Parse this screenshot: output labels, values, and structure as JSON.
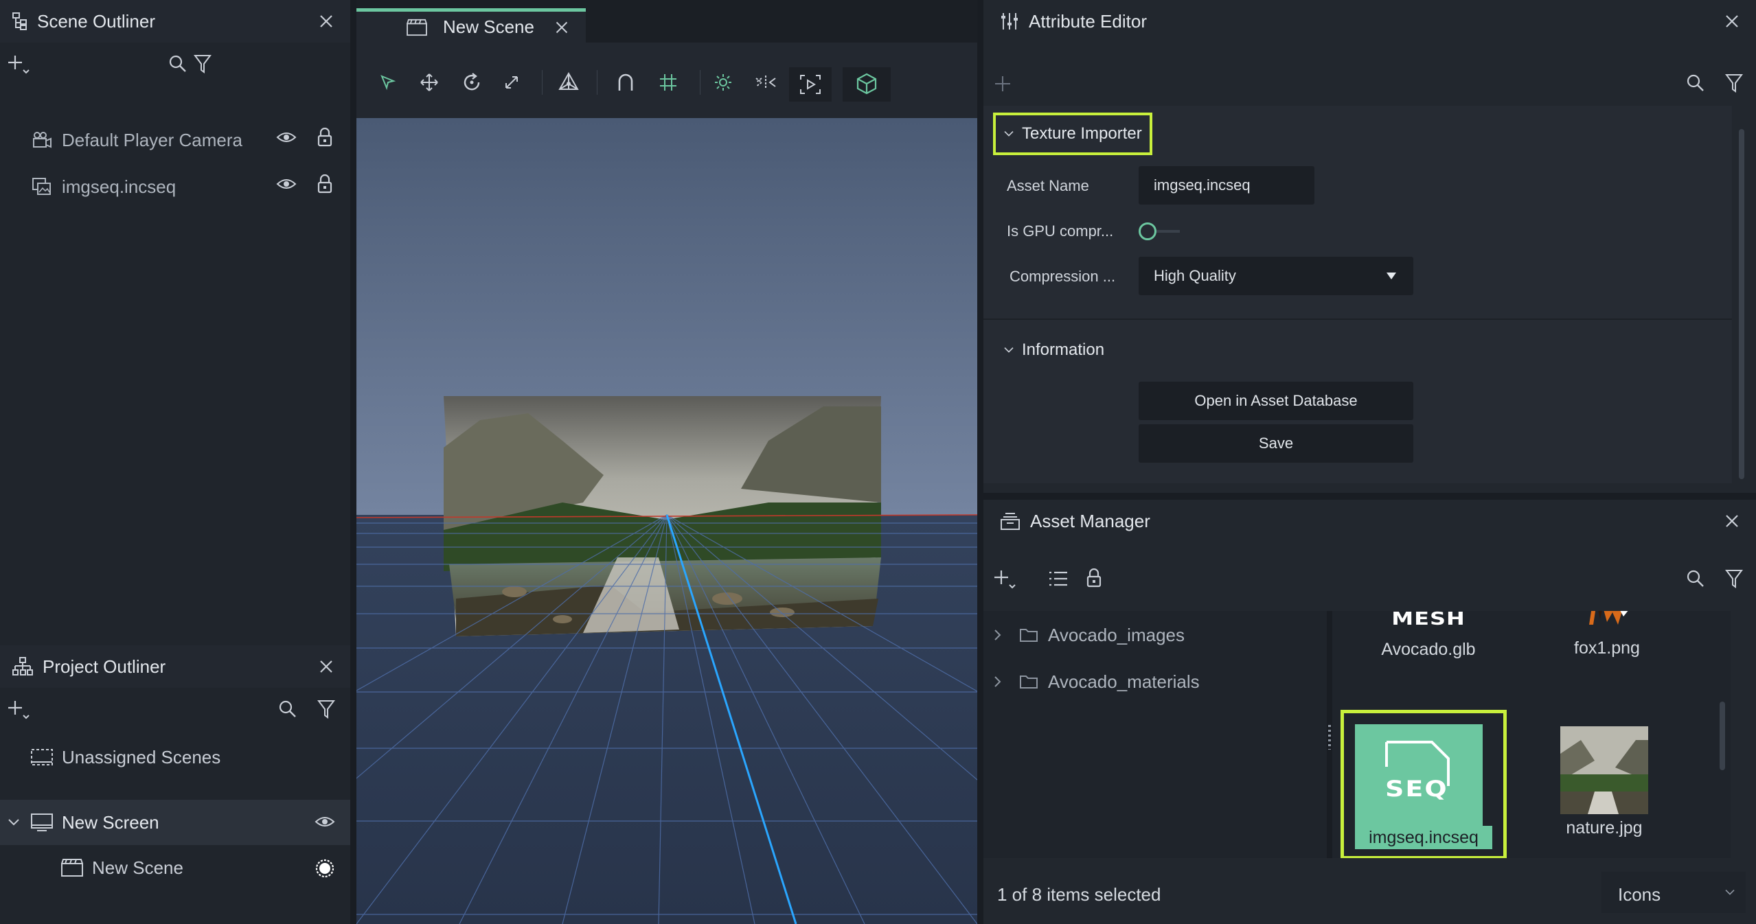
{
  "scene_outliner": {
    "title": "Scene Outliner",
    "items": [
      {
        "label": "Default Player Camera"
      },
      {
        "label": "imgseq.incseq"
      }
    ]
  },
  "project_outliner": {
    "title": "Project Outliner",
    "items": [
      {
        "label": "Unassigned Scenes"
      },
      {
        "label": "New Screen"
      },
      {
        "label": "New Scene"
      }
    ]
  },
  "viewport": {
    "tab_label": "New Scene"
  },
  "attribute_editor": {
    "title": "Attribute Editor",
    "texture_section": "Texture Importer",
    "asset_name_label": "Asset Name",
    "asset_name_value": "imgseq.incseq",
    "gpu_label": "Is GPU compr...",
    "compression_label": "Compression ...",
    "compression_value": "High Quality",
    "info_section": "Information",
    "open_btn": "Open in Asset Database",
    "save_btn": "Save"
  },
  "asset_manager": {
    "title": "Asset Manager",
    "folders": [
      {
        "label": "Avocado_images"
      },
      {
        "label": "Avocado_materials"
      }
    ],
    "assets": [
      {
        "label": "Avocado.glb",
        "thumb_text": "MESH"
      },
      {
        "label": "fox1.png"
      },
      {
        "label": "imgseq.incseq",
        "thumb_text": "SEQ"
      },
      {
        "label": "nature.jpg"
      }
    ],
    "status": "1 of 8 items selected",
    "view_mode": "Icons"
  },
  "colors": {
    "accent_green": "#c8f03c",
    "teal": "#6cc7a0",
    "tab_underline": "#6cc7a0"
  }
}
